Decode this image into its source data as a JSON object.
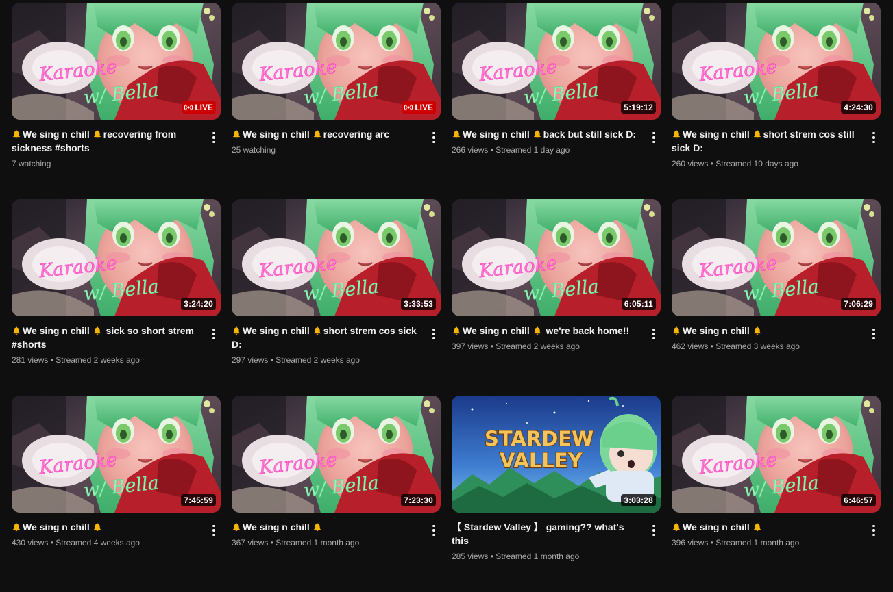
{
  "videos": [
    {
      "title": "We sing n chill 🔔recovering from sickness #shorts",
      "title_parts": [
        "We sing n chill ",
        "recovering from sickness #shorts"
      ],
      "meta": "7 watching",
      "badge": "LIVE",
      "is_live": true,
      "thumbnail": "karaoke-bella"
    },
    {
      "title": "We sing n chill recovering arc",
      "title_parts": [
        "We sing n chill ",
        "recovering arc"
      ],
      "meta": "25 watching",
      "badge": "LIVE",
      "is_live": true,
      "thumbnail": "karaoke-bella"
    },
    {
      "title": "We sing n chill back but still sick D:",
      "title_parts": [
        "We sing n chill ",
        "back but still sick D:"
      ],
      "meta": "266 views • Streamed 1 day ago",
      "badge": "5:19:12",
      "is_live": false,
      "thumbnail": "karaoke-bella"
    },
    {
      "title": "We sing n chill short strem cos still sick D:",
      "title_parts": [
        "We sing n chill ",
        "short strem cos still sick D:"
      ],
      "meta": "260 views • Streamed 10 days ago",
      "badge": "4:24:30",
      "is_live": false,
      "thumbnail": "karaoke-bella"
    },
    {
      "title": "We sing n chill sick so short strem #shorts",
      "title_parts": [
        "We sing n chill ",
        " sick so short strem #shorts"
      ],
      "meta": "281 views • Streamed 2 weeks ago",
      "badge": "3:24:20",
      "is_live": false,
      "thumbnail": "karaoke-bella"
    },
    {
      "title": "We sing n chill short strem cos sick D:",
      "title_parts": [
        "We sing n chill ",
        "short strem cos sick D:"
      ],
      "meta": "297 views • Streamed 2 weeks ago",
      "badge": "3:33:53",
      "is_live": false,
      "thumbnail": "karaoke-bella"
    },
    {
      "title": "We sing n chill we're back home!!",
      "title_parts": [
        "We sing n chill ",
        " we're back home!!"
      ],
      "meta": "397 views • Streamed 2 weeks ago",
      "badge": "6:05:11",
      "is_live": false,
      "thumbnail": "karaoke-bella"
    },
    {
      "title": "We sing n chill",
      "title_parts": [
        "We sing n chill ",
        ""
      ],
      "meta": "462 views • Streamed 3 weeks ago",
      "badge": "7:06:29",
      "is_live": false,
      "thumbnail": "karaoke-bella"
    },
    {
      "title": "We sing n chill",
      "title_parts": [
        "We sing n chill ",
        ""
      ],
      "meta": "430 views • Streamed 4 weeks ago",
      "badge": "7:45:59",
      "is_live": false,
      "thumbnail": "karaoke-bella"
    },
    {
      "title": "We sing n chill",
      "title_parts": [
        "We sing n chill ",
        ""
      ],
      "meta": "367 views • Streamed 1 month ago",
      "badge": "7:23:30",
      "is_live": false,
      "thumbnail": "karaoke-bella"
    },
    {
      "title": "【 Stardew Valley 】 gaming?? what's this",
      "title_parts": [
        "【 Stardew Valley 】 gaming?? what's this"
      ],
      "meta": "285 views • Streamed 1 month ago",
      "badge": "3:03:28",
      "is_live": false,
      "thumbnail": "stardew-valley"
    },
    {
      "title": "We sing n chill",
      "title_parts": [
        "We sing n chill ",
        ""
      ],
      "meta": "396 views • Streamed 1 month ago",
      "badge": "6:46:57",
      "is_live": false,
      "thumbnail": "karaoke-bella"
    }
  ],
  "thumb_text": {
    "karaoke_line1": "Karaoke",
    "karaoke_line2": "w/ Bella",
    "stardew_line1": "STARDEW",
    "stardew_line2": "VALLEY"
  },
  "icons": {
    "bell": "bell-icon",
    "live": "live-broadcast-icon",
    "more": "more-vertical-icon"
  },
  "colors": {
    "background": "#0f0f0f",
    "live_red": "#cc0000",
    "meta_gray": "#aaaaaa",
    "bell_gold": "#f7b500"
  }
}
